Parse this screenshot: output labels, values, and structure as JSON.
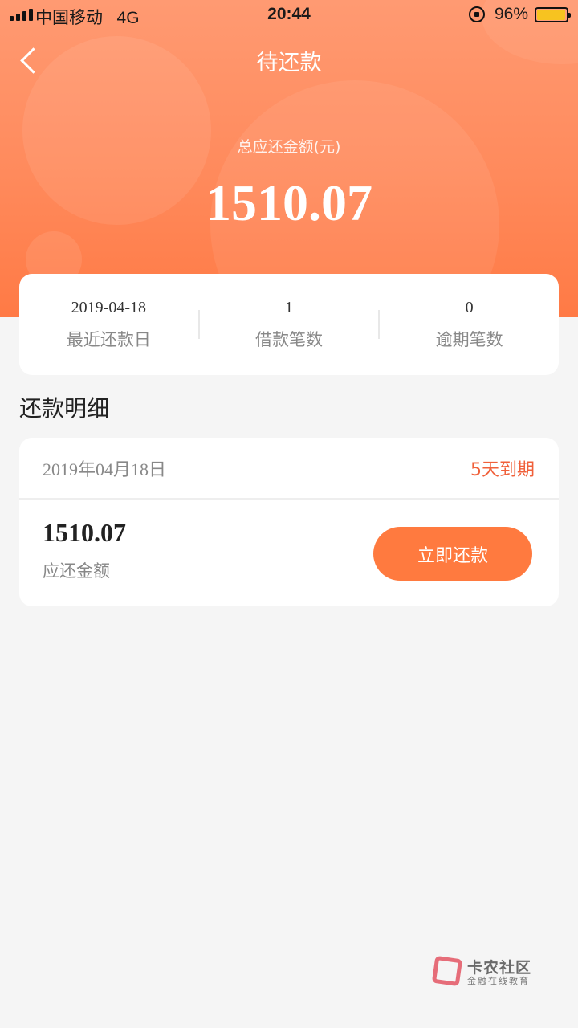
{
  "status_bar": {
    "carrier": "中国移动",
    "network": "4G",
    "time": "20:44",
    "battery_percent": "96%",
    "battery_level": 0.96
  },
  "nav": {
    "title": "待还款",
    "back_icon": "chevron-left-icon"
  },
  "hero": {
    "total_label": "总应还金额(元)",
    "total_amount": "1510.07"
  },
  "summary": {
    "items": [
      {
        "value": "2019-04-18",
        "label": "最近还款日"
      },
      {
        "value": "1",
        "label": "借款笔数"
      },
      {
        "value": "0",
        "label": "逾期笔数"
      }
    ]
  },
  "section": {
    "title": "还款明细"
  },
  "detail": {
    "date": "2019年04月18日",
    "due_status": "5天到期",
    "amount": "1510.07",
    "amount_label": "应还金额",
    "pay_button": "立即还款"
  },
  "watermark": {
    "title": "卡农社区",
    "subtitle": "金融在线教育"
  },
  "colors": {
    "accent": "#ff7a3f",
    "due_text": "#f0603a",
    "background": "#f5f5f5"
  }
}
